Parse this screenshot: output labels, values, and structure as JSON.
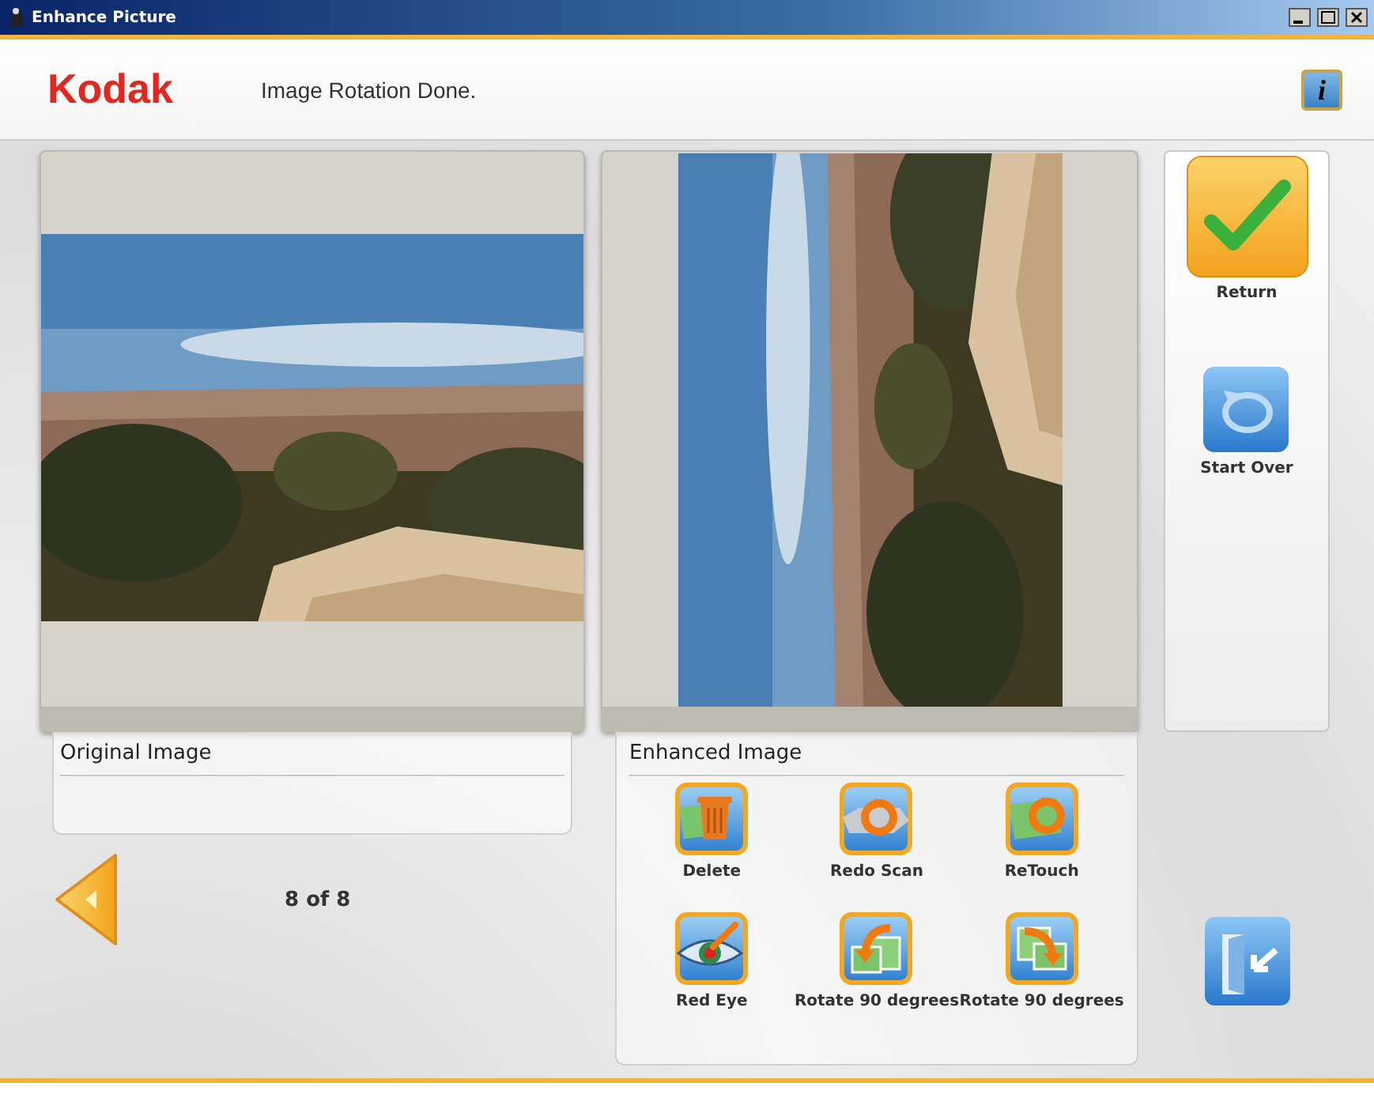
{
  "window": {
    "title": "Enhance Picture"
  },
  "header": {
    "logo": "Kodak",
    "message": "Image Rotation Done.",
    "info_button": "i"
  },
  "original": {
    "label": "Original Image",
    "counter": "8 of 8"
  },
  "enhanced": {
    "label": "Enhanced Image",
    "tools": [
      {
        "kind": "delete",
        "label": "Delete"
      },
      {
        "kind": "redo-scan",
        "label": "Redo Scan"
      },
      {
        "kind": "retouch",
        "label": "ReTouch"
      },
      {
        "kind": "red-eye",
        "label": "Red Eye"
      },
      {
        "kind": "rotate-left",
        "label": "Rotate 90 degrees"
      },
      {
        "kind": "rotate-right",
        "label": "Rotate 90 degrees"
      }
    ]
  },
  "sidebar": {
    "buttons": [
      {
        "kind": "return",
        "label": "Return"
      },
      {
        "kind": "start-over",
        "label": "Start Over"
      }
    ]
  }
}
